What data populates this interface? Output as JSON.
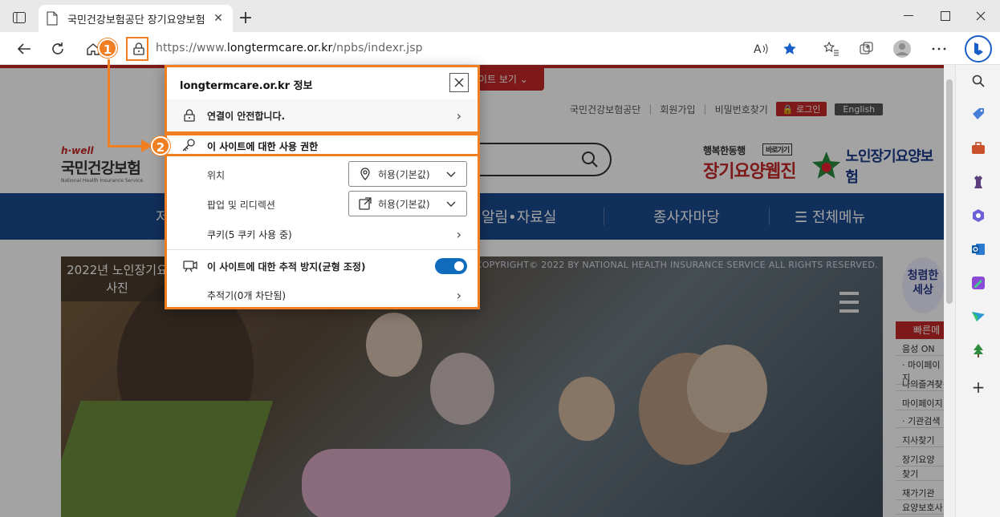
{
  "browser": {
    "tab_title": "국민건강보험공단 장기요양보험",
    "new_tab_glyph": "+",
    "address": {
      "prefix": "https://www.",
      "host": "longtermcare.or.kr",
      "path": "/npbs/indexr.jsp"
    },
    "accent_color": "#ef7f22"
  },
  "annotations": {
    "badge1": "1",
    "badge2": "2"
  },
  "popup": {
    "title": "longtermcare.or.kr 정보",
    "secure_label": "연결이 안전합니다.",
    "permissions_label": "이 사이트에 대한 사용 권한",
    "permissions": [
      {
        "label": "위치",
        "value": "허용(기본값)"
      },
      {
        "label": "팝업 및 리디렉션",
        "value": "허용(기본값)"
      }
    ],
    "cookies_label": "쿠키(5 쿠키 사용 중)",
    "tracking_label": "이 사이트에 대한 추적 방지(균형 조정)",
    "tracking_enabled": true,
    "trackers_label": "추적기(0개 차단됨)"
  },
  "page": {
    "promo_button": "이트 보기",
    "util_links": [
      "국민건강보험공단",
      "회원가입",
      "비밀번호찾기"
    ],
    "login_label": "로그인",
    "english_label": "English",
    "logo": {
      "hwell": "h·well",
      "name": "국민건강보험",
      "en": "National Health Insurance Service"
    },
    "brand1_small": "행복한동행",
    "brand1_go": "바로가기",
    "brand1_main": "장기요양웹진",
    "brand2": "노인장기요양보험",
    "nav": [
      "저",
      "알림•자료실",
      "종사자마당",
      "전체메뉴"
    ],
    "hero_caption_line1": "2022년 노인장기요",
    "hero_caption_line2": "사진",
    "hero_copyright": "COPYRIGHT© 2022 BY NATIONAL HEALTH INSURANCE SERVICE ALL RIGHTS RESERVED.",
    "quick_title": "빠른메",
    "quick_rows": [
      "음성  ON",
      "· 마이페이지",
      "나의즐겨찾",
      "마이페이지",
      "· 기관검색",
      "지사찾기",
      "장기요양",
      "찾기",
      "재가기관",
      "요양보호사"
    ],
    "cheongryeom": "청렴한 세상"
  }
}
